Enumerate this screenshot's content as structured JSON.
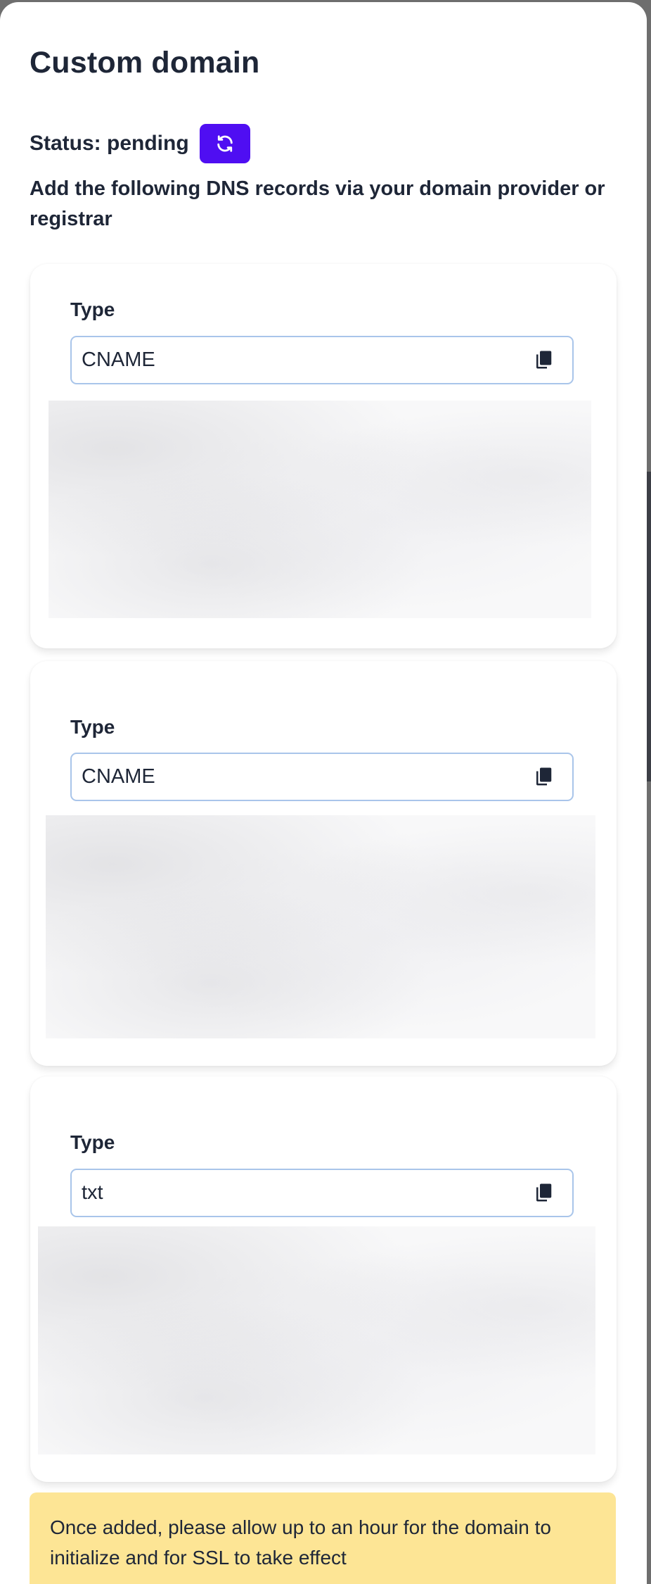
{
  "modal": {
    "title": "Custom domain",
    "status_text": "Status: pending",
    "instructions": "Add the following DNS records via your domain provider or registrar"
  },
  "records": [
    {
      "label": "Type",
      "value": "CNAME"
    },
    {
      "label": "Type",
      "value": "CNAME"
    },
    {
      "label": "Type",
      "value": "txt"
    }
  ],
  "notice": {
    "text": "Once added, please allow up to an hour for the domain to initialize and for SSL to take effect"
  },
  "icons": {
    "refresh": "refresh-icon",
    "copy": "copy-icon"
  },
  "colors": {
    "accent": "#4f0ef2",
    "notice_bg": "#fde595",
    "field_border": "#a9c5ea",
    "text": "#1e2637"
  }
}
